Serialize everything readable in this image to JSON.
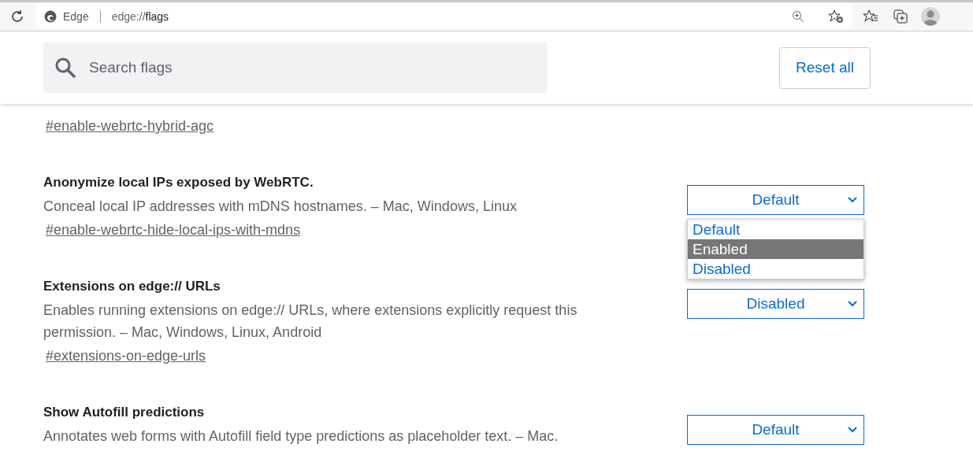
{
  "browser": {
    "brand": "Edge",
    "url_scheme": "edge://",
    "url_path": "flags"
  },
  "search": {
    "placeholder": "Search flags"
  },
  "reset_button": "Reset all",
  "flags": [
    {
      "link": "#enable-webrtc-hybrid-agc"
    },
    {
      "title": "Anonymize local IPs exposed by WebRTC.",
      "description": "Conceal local IP addresses with mDNS hostnames. – Mac, Windows, Linux",
      "link": "#enable-webrtc-hide-local-ips-with-mdns",
      "select": {
        "value": "Default",
        "options": [
          {
            "label": "Default",
            "highlighted": false
          },
          {
            "label": "Enabled",
            "highlighted": true
          },
          {
            "label": "Disabled",
            "highlighted": false
          }
        ]
      }
    },
    {
      "title": "Extensions on edge:// URLs",
      "description": "Enables running extensions on edge:// URLs, where extensions explicitly request this permission. – Mac, Windows, Linux, Android",
      "link": "#extensions-on-edge-urls",
      "select": {
        "value": "Disabled"
      }
    },
    {
      "title": "Show Autofill predictions",
      "description": "Annotates web forms with Autofill field type predictions as placeholder text. – Mac.",
      "select": {
        "value": "Default"
      }
    }
  ]
}
